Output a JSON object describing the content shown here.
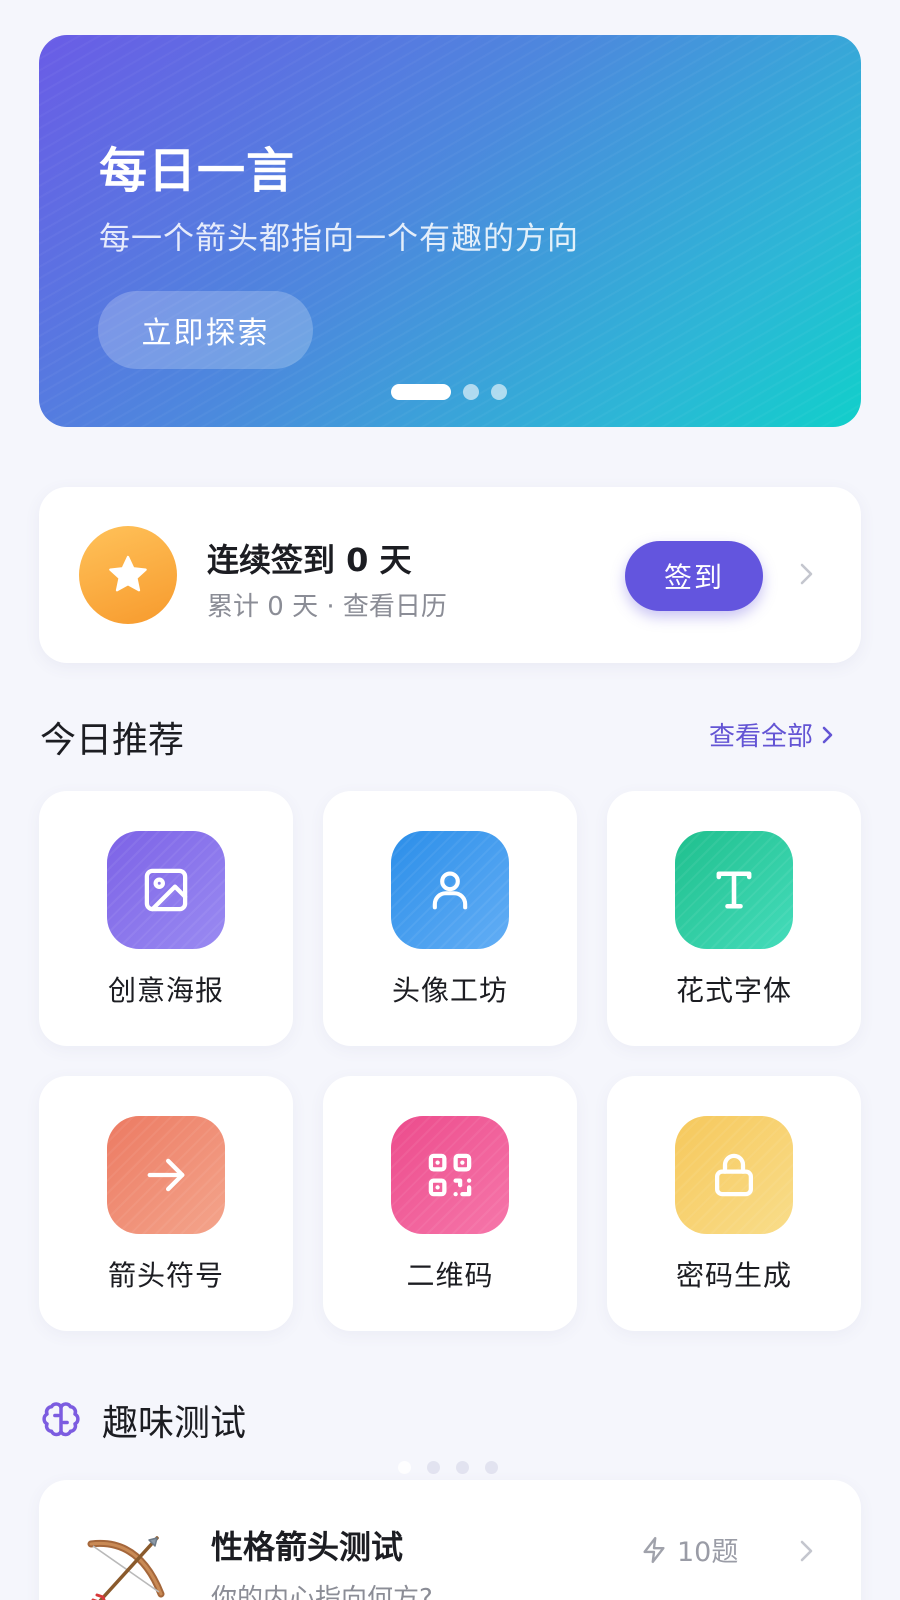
{
  "banner": {
    "title": "每日一言",
    "subtitle": "每一个箭头都指向一个有趣的方向",
    "button_label": "立即探索",
    "page_count": 3,
    "active_page": 1
  },
  "checkin": {
    "title": "连续签到 0 天",
    "subtitle": "累计 0 天 · 查看日历",
    "button_label": "签到",
    "icon": "star-icon"
  },
  "recommend": {
    "title": "今日推荐",
    "view_all": "查看全部",
    "items": [
      {
        "label": "创意海报",
        "icon": "image-icon",
        "color": "#7c62e6"
      },
      {
        "label": "头像工坊",
        "icon": "user-icon",
        "color": "#2b8ee9"
      },
      {
        "label": "花式字体",
        "icon": "text-t-icon",
        "color": "#1fbf8d"
      },
      {
        "label": "箭头符号",
        "icon": "arrow-right-icon",
        "color": "#ec7a62"
      },
      {
        "label": "二维码",
        "icon": "qr-code-icon",
        "color": "#ec4b8c"
      },
      {
        "label": "密码生成",
        "icon": "lock-icon",
        "color": "#f6c85c"
      }
    ]
  },
  "fun_test": {
    "title": "趣味测试",
    "icon": "brain-icon",
    "card": {
      "title": "性格箭头测试",
      "subtitle": "你的内心指向何方?",
      "count": "10题",
      "icon": "bow-arrow-icon"
    }
  },
  "colors": {
    "accent": "#6355de",
    "background": "#f5f6fc"
  }
}
